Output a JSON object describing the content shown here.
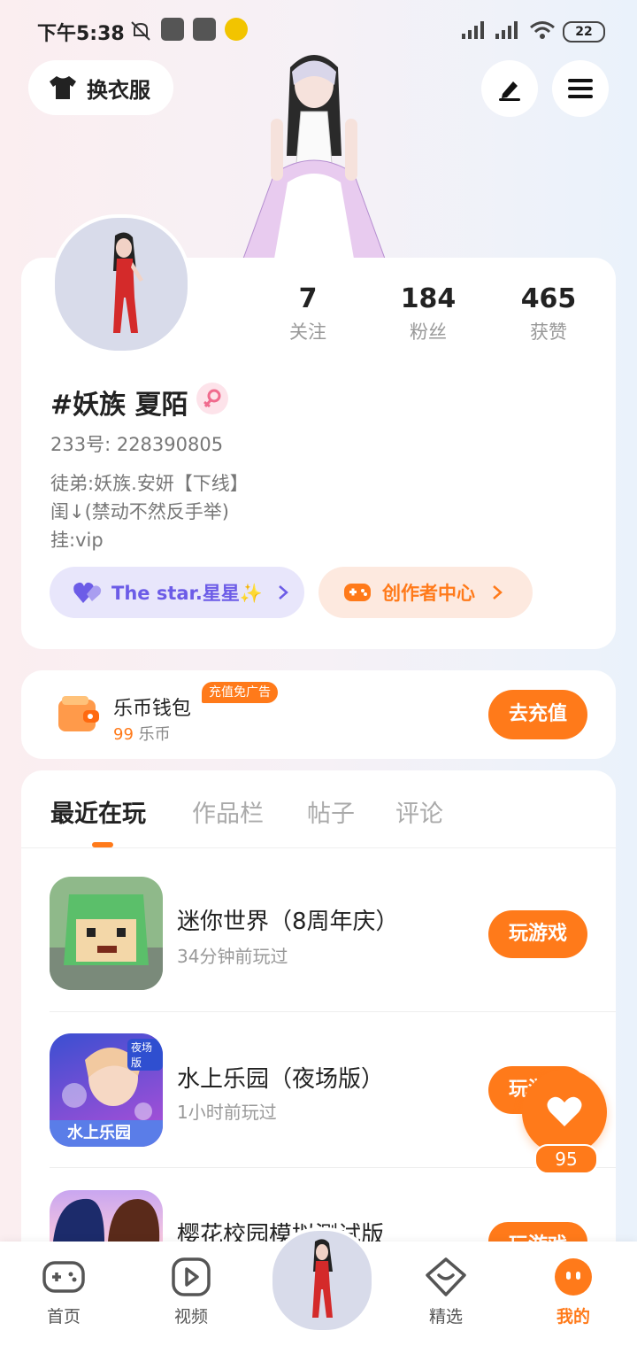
{
  "status_bar": {
    "time": "下午5:38",
    "battery": "22"
  },
  "top": {
    "outfit_label": "换衣服",
    "edit_icon": "pencil-icon",
    "menu_icon": "menu-icon"
  },
  "profile": {
    "stats": [
      {
        "value": "7",
        "label": "关注"
      },
      {
        "value": "184",
        "label": "粉丝"
      },
      {
        "value": "465",
        "label": "获赞"
      }
    ],
    "name": "#妖族 夏陌",
    "uid": "233号: 228390805",
    "bio": [
      "徒弟:妖族.安妍【下线】",
      "闺↓(禁动不然反手举)",
      "挂:vip"
    ],
    "star_label": "The star.星星✨",
    "creator_label": "创作者中心"
  },
  "wallet": {
    "title": "乐币钱包",
    "badge": "充值免广告",
    "amount": "99",
    "unit": "乐币",
    "button": "去充值"
  },
  "tabs": [
    "最近在玩",
    "作品栏",
    "帖子",
    "评论"
  ],
  "games": [
    {
      "title": "迷你世界（8周年庆）",
      "time": "34分钟前玩过",
      "button": "玩游戏"
    },
    {
      "title": "水上乐园（夜场版）",
      "time": "1小时前玩过",
      "button": "玩游戏",
      "icon_text": "水上乐园",
      "icon_badge": "夜场版"
    },
    {
      "title": "樱花校园模拟测试版",
      "time": "",
      "button": "玩游戏"
    }
  ],
  "like_count": "95",
  "nav": [
    {
      "label": "首页",
      "icon": "gamepad-icon"
    },
    {
      "label": "视频",
      "icon": "video-icon"
    },
    {
      "label": "精选",
      "icon": "heart-box-icon"
    },
    {
      "label": "我的",
      "icon": "profile-face-icon",
      "active": true
    }
  ],
  "colors": {
    "accent": "#ff7a1a",
    "star_purple": "#6c5ce7"
  }
}
